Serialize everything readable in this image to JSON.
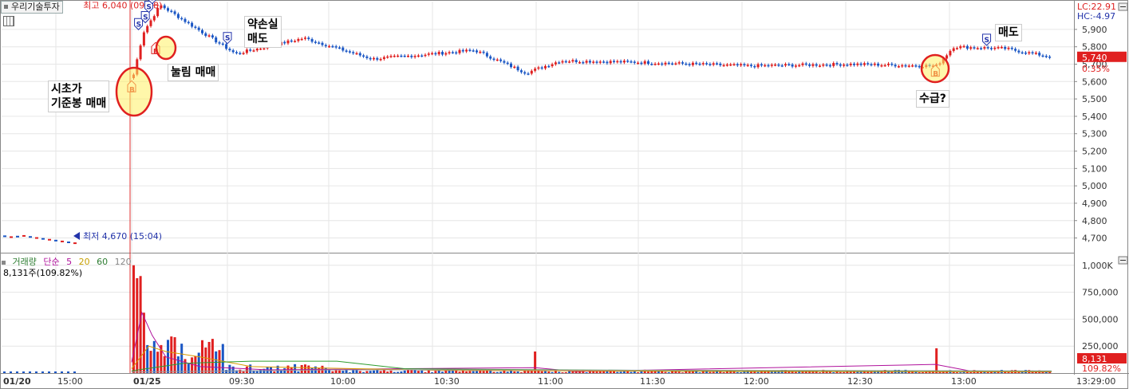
{
  "window": {
    "title": "우리기술투자"
  },
  "price_panel": {
    "high_label": "최고 6,040 (09:08)",
    "low_label": "최저 4,670 (15:04)",
    "lc_label": "LC:22.91",
    "hc_label": "HC:-4.97",
    "current_price": "5,740",
    "current_pct": "0.35%"
  },
  "annotations": {
    "open_base": "시초가\n기준봉 매매",
    "pullback": "눌림 매매",
    "stop_loss": "약손실\n매도",
    "supply": "수급?",
    "sell": "매도"
  },
  "volume_panel": {
    "legend": [
      "거래량",
      "단순",
      "5",
      "20",
      "60",
      "120"
    ],
    "legend_colors": [
      "#2e7d32",
      "#b0129c",
      "#b0129c",
      "#c8a000",
      "#2e7d32",
      "#888888"
    ],
    "sub_label": "8,131주(109.82%)",
    "current_volume": "8,131",
    "current_ratio": "109.82%"
  },
  "colors": {
    "up": "#e02020",
    "down": "#1a56c4",
    "ma5": "#b0129c",
    "ma20": "#d99a00",
    "ma60": "#2e9c2e",
    "ma120": "#999999"
  },
  "chart_data": [
    {
      "type": "candlestick",
      "title": "우리기술투자",
      "y_ticks": [
        "5,900",
        "5,800",
        "5,700",
        "5,600",
        "5,500",
        "5,400",
        "5,300",
        "5,200",
        "5,100",
        "5,000",
        "4,900",
        "4,800",
        "4,700"
      ],
      "ylim": [
        4620,
        6060
      ],
      "x_ticks": [
        "01/20",
        "15:00",
        "01/25",
        "09:30",
        "10:00",
        "10:30",
        "11:00",
        "11:30",
        "12:00",
        "12:30",
        "13:00",
        "13:29:00"
      ],
      "prev_session_close_segment": [
        4710,
        4705,
        4708,
        4712,
        4706,
        4700,
        4695,
        4690,
        4685,
        4680,
        4675,
        4670
      ],
      "key_points": [
        {
          "time": "09:00",
          "price": 5620
        },
        {
          "time": "09:03",
          "price": 5880
        },
        {
          "time": "09:08",
          "price": 6040
        },
        {
          "time": "09:30",
          "price": 5760
        },
        {
          "time": "09:50",
          "price": 5850
        },
        {
          "time": "10:10",
          "price": 5730
        },
        {
          "time": "10:40",
          "price": 5780
        },
        {
          "time": "10:55",
          "price": 5650
        },
        {
          "time": "11:05",
          "price": 5720
        },
        {
          "time": "11:30",
          "price": 5710
        },
        {
          "time": "12:00",
          "price": 5690
        },
        {
          "time": "12:30",
          "price": 5700
        },
        {
          "time": "12:55",
          "price": 5690
        },
        {
          "time": "13:00",
          "price": 5800
        },
        {
          "time": "13:15",
          "price": 5790
        },
        {
          "time": "13:29",
          "price": 5740
        }
      ],
      "trade_marks": [
        {
          "kind": "B",
          "time": "09:00",
          "price": 5600
        },
        {
          "kind": "S",
          "time": "09:02",
          "price": 5880
        },
        {
          "kind": "S",
          "time": "09:04",
          "price": 5920
        },
        {
          "kind": "S",
          "time": "09:05",
          "price": 5980
        },
        {
          "kind": "S",
          "time": "09:06",
          "price": 6030
        },
        {
          "kind": "B",
          "time": "09:07",
          "price": 5820
        },
        {
          "kind": "S",
          "time": "09:28",
          "price": 5800
        },
        {
          "kind": "B",
          "time": "12:55",
          "price": 5690
        },
        {
          "kind": "S",
          "time": "13:10",
          "price": 5790
        }
      ]
    },
    {
      "type": "bar",
      "title": "거래량",
      "y_ticks": [
        "1,000K",
        "750,000",
        "500,000",
        "250,000"
      ],
      "ylim": [
        0,
        1050000
      ],
      "series": [
        {
          "name": "거래량",
          "peaks": [
            {
              "time": "09:00",
              "value": 1000000
            },
            {
              "time": "09:01",
              "value": 880000
            },
            {
              "time": "09:02",
              "value": 900000
            },
            {
              "time": "09:03",
              "value": 560000
            },
            {
              "time": "10:58",
              "value": 200000
            },
            {
              "time": "12:55",
              "value": 230000
            }
          ]
        }
      ]
    }
  ]
}
